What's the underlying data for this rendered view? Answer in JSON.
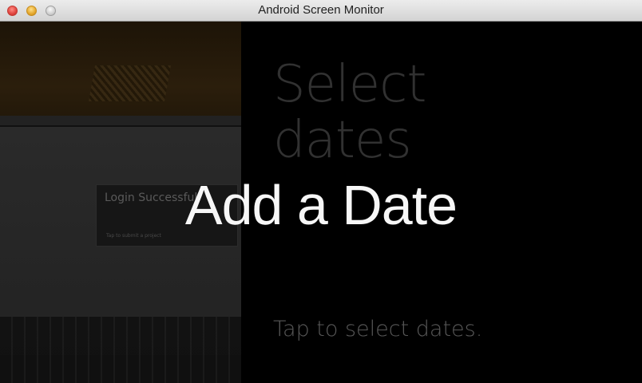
{
  "window": {
    "title": "Android Screen Monitor"
  },
  "camera_background": {
    "dialog_title": "Login Successful",
    "dialog_subtitle": "Tap to submit a project"
  },
  "card": {
    "heading": "Select dates",
    "hint": "Tap to select dates."
  },
  "overlay": {
    "title": "Add a Date"
  }
}
